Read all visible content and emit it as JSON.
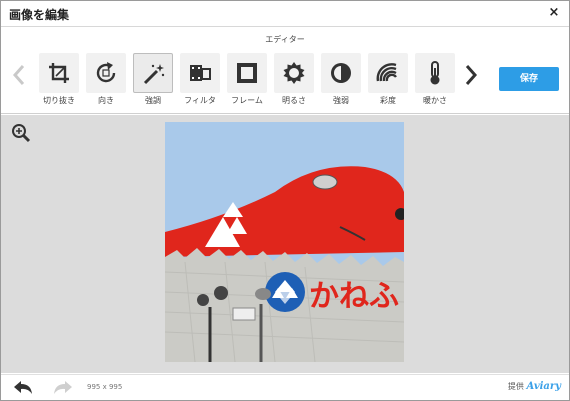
{
  "dialog": {
    "title": "画像を編集",
    "close_glyph": "×"
  },
  "toolbar": {
    "heading": "エディター",
    "save_label": "保存",
    "tools": [
      {
        "label": "切り抜き",
        "icon": "crop-icon",
        "active": false
      },
      {
        "label": "向き",
        "icon": "rotate-icon",
        "active": false
      },
      {
        "label": "強調",
        "icon": "magic-wand-icon",
        "active": true
      },
      {
        "label": "フィルタ",
        "icon": "filter-icon",
        "active": false
      },
      {
        "label": "フレーム",
        "icon": "frame-icon",
        "active": false
      },
      {
        "label": "明るさ",
        "icon": "brightness-icon",
        "active": false
      },
      {
        "label": "強弱",
        "icon": "contrast-icon",
        "active": false
      },
      {
        "label": "彩度",
        "icon": "saturation-icon",
        "active": false
      },
      {
        "label": "暖かさ",
        "icon": "thermometer-icon",
        "active": false
      }
    ]
  },
  "photo": {
    "sign_text": "かねふ"
  },
  "footer": {
    "dimensions": "995 x 995",
    "credit_prefix": "提供",
    "credit_brand": "Aviary"
  },
  "colors": {
    "save_button": "#2d9de6",
    "canvas_bg": "#dcdcdc",
    "sky": "#a9c9ea",
    "red": "#e0261c"
  }
}
